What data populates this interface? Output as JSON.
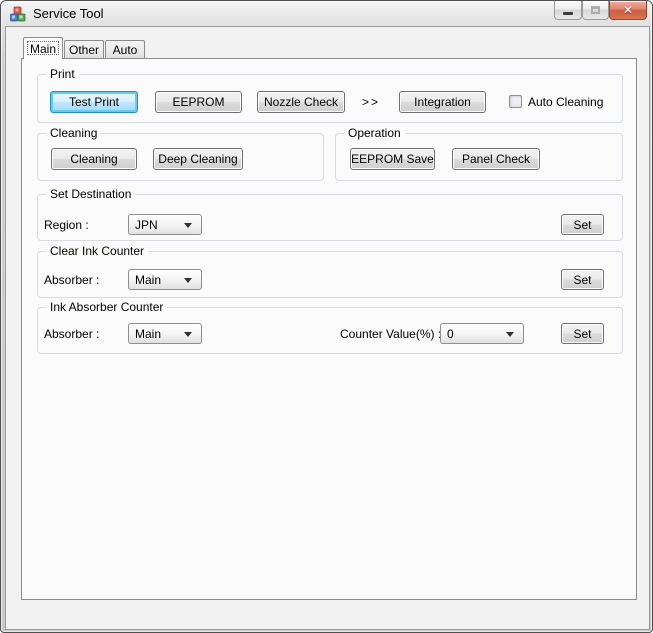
{
  "window": {
    "title": "Service Tool"
  },
  "tabs": {
    "main": "Main",
    "other": "Other",
    "auto": "Auto"
  },
  "print": {
    "title": "Print",
    "test_print": "Test Print",
    "eeprom": "EEPROM",
    "nozzle_check": "Nozzle Check",
    "separator": ">>",
    "integration": "Integration",
    "auto_cleaning": "Auto Cleaning",
    "auto_cleaning_checked": false
  },
  "cleaning": {
    "title": "Cleaning",
    "cleaning": "Cleaning",
    "deep_cleaning": "Deep Cleaning"
  },
  "operation": {
    "title": "Operation",
    "eeprom_save": "EEPROM Save",
    "panel_check": "Panel Check"
  },
  "set_destination": {
    "title": "Set Destination",
    "region_label": "Region :",
    "region_value": "JPN",
    "set": "Set"
  },
  "clear_ink_counter": {
    "title": "Clear Ink Counter",
    "absorber_label": "Absorber :",
    "absorber_value": "Main",
    "set": "Set"
  },
  "ink_absorber_counter": {
    "title": "Ink Absorber Counter",
    "absorber_label": "Absorber :",
    "absorber_value": "Main",
    "counter_label": "Counter Value(%) :",
    "counter_value": "0",
    "set": "Set"
  },
  "colors": {
    "default_button_border": "#2A8BC9",
    "default_button_glow": "#63CCF2",
    "close_button_red": "#CB5F44",
    "group_border": "#D7DCE2",
    "dialog_bg": "#F2F2F2",
    "page_bg": "#FBFBFB"
  }
}
